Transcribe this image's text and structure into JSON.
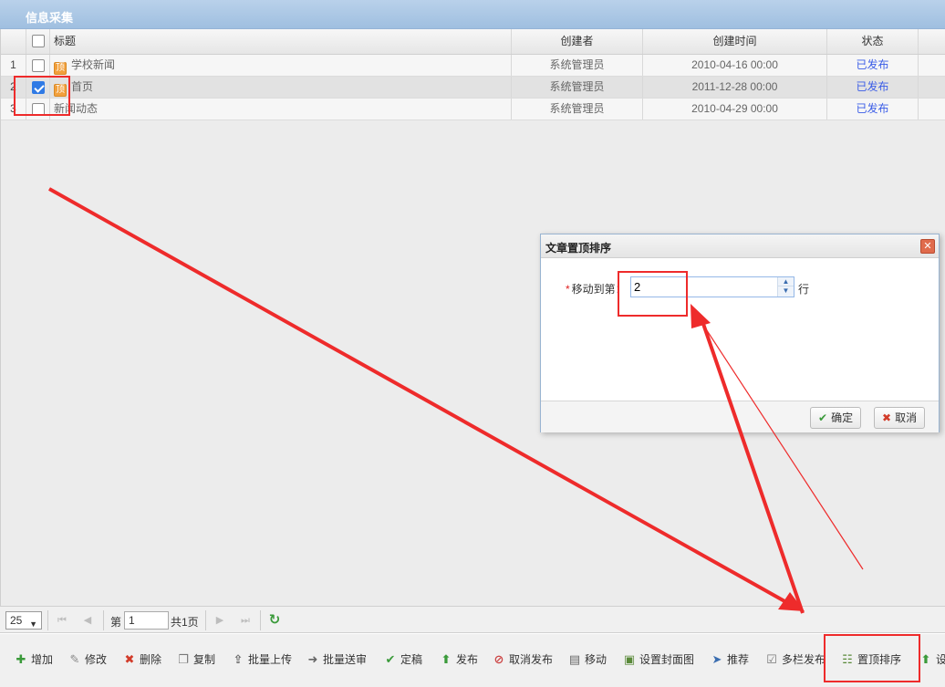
{
  "panel": {
    "title": "信息采集"
  },
  "grid": {
    "columns": [
      "标题",
      "创建者",
      "创建时间",
      "状态"
    ],
    "rows": [
      {
        "num": "1",
        "checked": false,
        "badge": "顶",
        "title": "学校新闻",
        "creator": "系统管理员",
        "time": "2010-04-16 00:00",
        "status": "已发布"
      },
      {
        "num": "2",
        "checked": true,
        "badge": "顶",
        "title": "首页",
        "creator": "系统管理员",
        "time": "2011-12-28 00:00",
        "status": "已发布"
      },
      {
        "num": "3",
        "checked": false,
        "badge": "",
        "title": "新闻动态",
        "creator": "系统管理员",
        "time": "2010-04-29 00:00",
        "status": "已发布"
      }
    ]
  },
  "pager": {
    "page_size": "25",
    "page_label": "第",
    "page_value": "1",
    "total_label": "共1页"
  },
  "toolbar": {
    "buttons": [
      {
        "label": "增加",
        "icon": "plus-icon"
      },
      {
        "label": "修改",
        "icon": "pencil-icon"
      },
      {
        "label": "删除",
        "icon": "delete-x-icon"
      },
      {
        "label": "复制",
        "icon": "copy-icon"
      },
      {
        "label": "批量上传",
        "icon": "upload-icon"
      },
      {
        "label": "批量送审",
        "icon": "send-review-icon"
      },
      {
        "label": "定稿",
        "icon": "check-icon"
      },
      {
        "label": "发布",
        "icon": "publish-icon"
      },
      {
        "label": "取消发布",
        "icon": "unpublish-icon"
      },
      {
        "label": "移动",
        "icon": "move-icon"
      },
      {
        "label": "设置封面图",
        "icon": "cover-image-icon"
      },
      {
        "label": "推荐",
        "icon": "recommend-icon"
      },
      {
        "label": "多栏发布",
        "icon": "multi-column-icon"
      },
      {
        "label": "置顶排序",
        "icon": "pin-sort-icon"
      },
      {
        "label": "设",
        "icon": "settings-icon"
      }
    ]
  },
  "dialog": {
    "title": "文章置顶排序",
    "required_mark": "*",
    "field_label": "移动到第：",
    "field_value": "2",
    "unit": "行",
    "ok_label": "确定",
    "cancel_label": "取消"
  }
}
